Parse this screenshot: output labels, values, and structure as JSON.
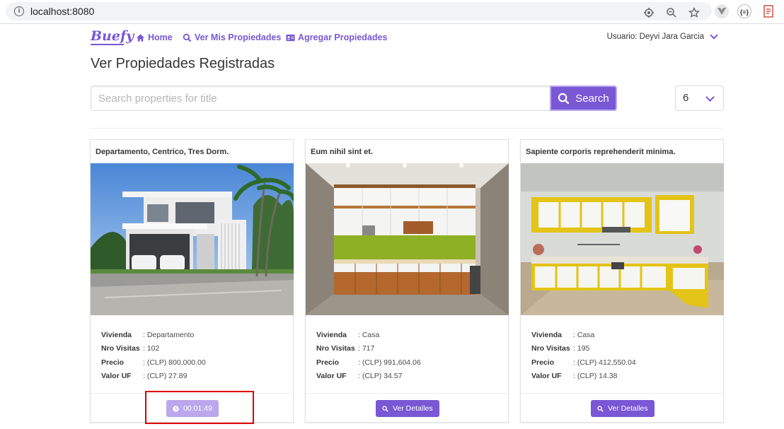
{
  "browser": {
    "url": "localhost:8080"
  },
  "navbar": {
    "logo": "Buefy",
    "links": [
      {
        "label": "Home",
        "icon": "home-icon"
      },
      {
        "label": "Ver Mis Propiedades",
        "icon": "search-icon"
      },
      {
        "label": "Agregar Propiedades",
        "icon": "id-card-icon"
      }
    ],
    "user": "Usuario: Deyvi Jara Garcia"
  },
  "page": {
    "title": "Ver Propiedades Registradas"
  },
  "search": {
    "placeholder": "Search properties for title",
    "button_label": "Search",
    "per_page": "6"
  },
  "cards": [
    {
      "title": "Departamento, Centrico, Tres Dorm.",
      "image": "modern-house-photo",
      "labels": [
        "Vivienda",
        "Nro Visitas",
        "Precio",
        "Valor UF"
      ],
      "values": [
        ": Departamento",
        ": 102",
        ": (CLP) 800,000.00",
        ": (CLP) 27.89"
      ],
      "action": "00:01:49",
      "action_icon": "clock-icon"
    },
    {
      "title": "Eum nihil sint et.",
      "image": "kitchen-green-photo",
      "labels": [
        "Vivienda",
        "Nro Visitas",
        "Precio",
        "Valor UF"
      ],
      "values": [
        ": Casa",
        ": 717",
        ": (CLP) 991,604.06",
        ": (CLP) 34.57"
      ],
      "action": "Ver Detalles",
      "action_icon": "search-icon"
    },
    {
      "title": "Sapiente corporis reprehenderit minima.",
      "image": "kitchen-yellow-photo",
      "labels": [
        "Vivienda",
        "Nro Visitas",
        "Precio",
        "Valor UF"
      ],
      "values": [
        ": Casa",
        ": 195",
        ": (CLP) 412,550.04",
        ": (CLP) 14.38"
      ],
      "action": "Ver Detalles",
      "action_icon": "search-icon"
    }
  ],
  "colors": {
    "primary": "#7957d5",
    "primary_light": "#bca7ec",
    "highlight": "#e00000"
  }
}
